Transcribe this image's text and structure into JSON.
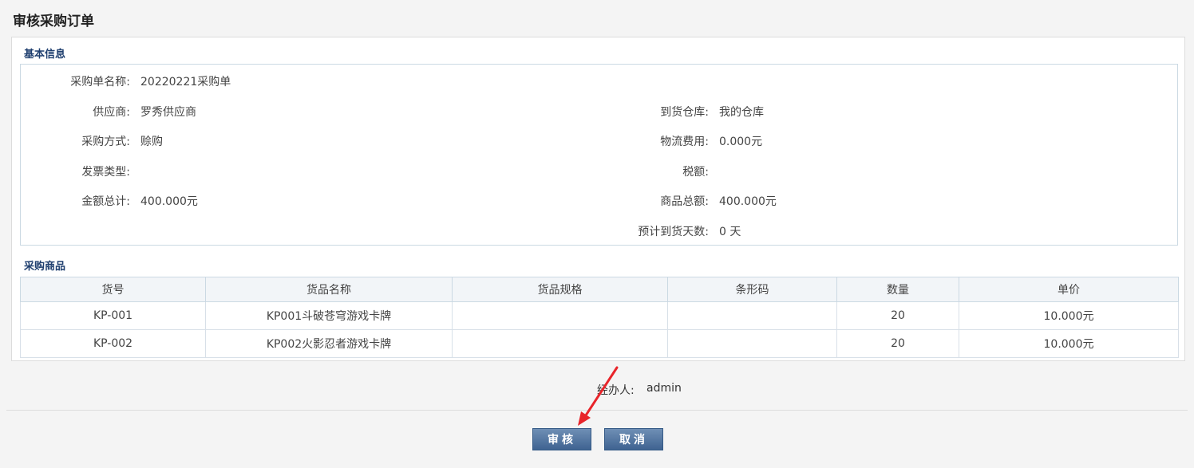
{
  "page": {
    "title": "审核采购订单"
  },
  "basic": {
    "section_title": "基本信息",
    "order_name_label": "采购单名称:",
    "order_name": "20220221采购单",
    "supplier_label": "供应商:",
    "supplier": "罗秀供应商",
    "warehouse_label": "到货仓库:",
    "warehouse": "我的仓库",
    "method_label": "采购方式:",
    "method": "赊购",
    "logistics_label": "物流费用:",
    "logistics": "0.000元",
    "invoice_label": "发票类型:",
    "invoice": "",
    "tax_label": "税额:",
    "tax": "",
    "total_label": "金额总计:",
    "total": "400.000元",
    "goods_total_label": "商品总额:",
    "goods_total": "400.000元",
    "days_label": "预计到货天数:",
    "days": "0 天"
  },
  "goods": {
    "section_title": "采购商品",
    "headers": [
      "货号",
      "货品名称",
      "货品规格",
      "条形码",
      "数量",
      "单价"
    ],
    "rows": [
      [
        "KP-001",
        "KP001斗破苍穹游戏卡牌",
        "",
        "",
        "20",
        "10.000元"
      ],
      [
        "KP-002",
        "KP002火影忍者游戏卡牌",
        "",
        "",
        "20",
        "10.000元"
      ]
    ]
  },
  "handler": {
    "label": "经办人:",
    "value": "admin"
  },
  "buttons": {
    "approve": "审核",
    "cancel": "取消"
  },
  "colors": {
    "accent": "#3f6391",
    "section_title": "#1f3f6f",
    "arrow": "#e8242a"
  }
}
